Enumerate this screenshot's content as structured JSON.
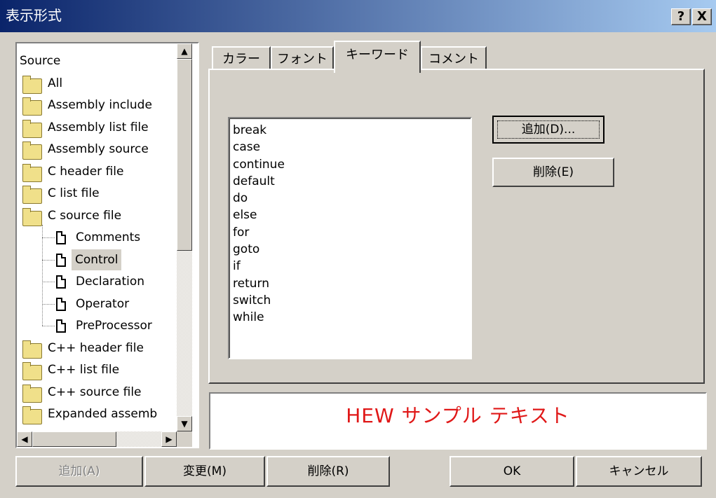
{
  "window": {
    "title": "表示形式",
    "help_label": "?",
    "close_label": "X"
  },
  "tree": {
    "root": "Source",
    "items": [
      {
        "label": "All",
        "kind": "folder"
      },
      {
        "label": "Assembly include",
        "kind": "folder"
      },
      {
        "label": "Assembly list file",
        "kind": "folder"
      },
      {
        "label": "Assembly source",
        "kind": "folder"
      },
      {
        "label": "C header file",
        "kind": "folder"
      },
      {
        "label": "C list file",
        "kind": "folder"
      },
      {
        "label": "C source file",
        "kind": "folder"
      },
      {
        "label": "Comments",
        "kind": "document"
      },
      {
        "label": "Control",
        "kind": "document",
        "selected": true
      },
      {
        "label": "Declaration",
        "kind": "document"
      },
      {
        "label": "Operator",
        "kind": "document"
      },
      {
        "label": "PreProcessor",
        "kind": "document"
      },
      {
        "label": "C++ header file",
        "kind": "folder"
      },
      {
        "label": "C++ list file",
        "kind": "folder"
      },
      {
        "label": "C++ source file",
        "kind": "folder"
      },
      {
        "label": "Expanded assemb",
        "kind": "folder"
      }
    ]
  },
  "tabs": [
    {
      "label": "カラー"
    },
    {
      "label": "フォント"
    },
    {
      "label": "キーワード",
      "active": true
    },
    {
      "label": "コメント"
    }
  ],
  "keywords": [
    "break",
    "case",
    "continue",
    "default",
    "do",
    "else",
    "for",
    "goto",
    "if",
    "return",
    "switch",
    "while"
  ],
  "keyword_buttons": {
    "add": "追加(D)...",
    "delete": "削除(E)"
  },
  "sample_text": "HEW サンプル テキスト",
  "sample_color": "#e01818",
  "bottom_buttons": {
    "add": "追加(A)",
    "change": "変更(M)",
    "delete": "削除(R)",
    "ok": "OK",
    "cancel": "キャンセル"
  },
  "colors": {
    "titlebar_start": "#0a246a",
    "titlebar_end": "#a6caf0",
    "face": "#d4d0c8"
  }
}
